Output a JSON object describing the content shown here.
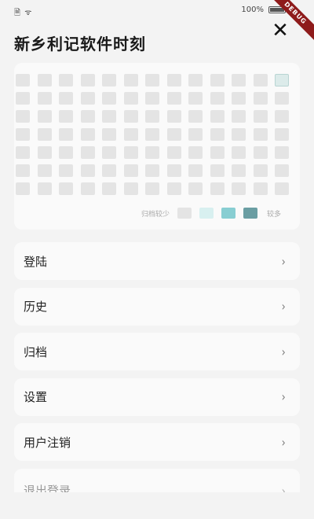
{
  "status_bar": {
    "left_icons": "🗎 ᯤ",
    "battery_text": "100%",
    "battery_level": 1.0
  },
  "debug_banner": "DEBUG",
  "close_icon_glyph": "✕",
  "title": "新乡利记软件时刻",
  "heatmap": {
    "rows": 7,
    "cols": 13,
    "empty_color": "#e4e4e4",
    "highlight": {
      "row": 0,
      "col": 12,
      "color": "#dcebea",
      "border": "#b9d5d3"
    },
    "legend": {
      "less_label": "归档较少",
      "more_label": "较多",
      "colors": [
        "#e4e4e4",
        "#d8f0f0",
        "#88ced2",
        "#6a9ea3"
      ]
    }
  },
  "menu": [
    {
      "label": "登陆"
    },
    {
      "label": "历史"
    },
    {
      "label": "归档"
    },
    {
      "label": "设置"
    },
    {
      "label": "用户注销"
    },
    {
      "label": "退出登录"
    }
  ],
  "chevron_glyph": "›"
}
